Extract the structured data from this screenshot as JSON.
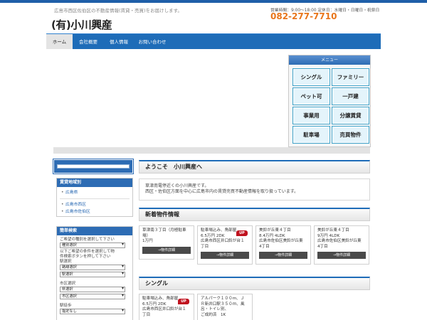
{
  "header": {
    "tagline": "広島市西区佐伯区の不動産情報(賃貸・売買)をお届けします。",
    "logo": "(有)小川興産",
    "hours": "営業時間：9:00〜18:00 定休日：水曜日・日曜日・祝祭日",
    "phone": "082-277-7710"
  },
  "nav": {
    "items": [
      {
        "label": "ホーム"
      },
      {
        "label": "会社概要"
      },
      {
        "label": "個人情報"
      },
      {
        "label": "お問い合わせ"
      }
    ]
  },
  "menu": {
    "title": "メニュー",
    "buttons": [
      "シングル",
      "ファミリー",
      "ペット可",
      "一戸建",
      "事業用",
      "分譲賃貸",
      "駐車場",
      "売買物件"
    ]
  },
  "sidebar": {
    "area_title": "賃貸地域別",
    "area_links": [
      "広島県",
      "広島市西区",
      "広島市佐伯区"
    ],
    "search_title": "簡単検索",
    "search_lines": [
      "ご希望の種別を選択して下さい"
    ],
    "type_select": "種別選択",
    "search_lines2": [
      "以下ご希望の条件を選択して物",
      "件検索ボタンを押して下さい"
    ],
    "station_label": "駅選択",
    "route_select": "路線選択",
    "station_select": "駅選択",
    "city_label": "市区選択",
    "pref_select": "県選択",
    "city_select": "市区選択",
    "walk_label": "駅徒歩",
    "walk_select": "指定なし"
  },
  "welcome": {
    "title": "ようこそ　小川興産へ",
    "line1": "草津南電停近くの小川興産です。",
    "line2": "西区・佐伯区方面を中心に広島市内の賃貸売買不動産情報を取り扱っています。"
  },
  "new_listings": {
    "title": "新着物件情報",
    "detail_label": "→物件詳細",
    "up_label": "UP",
    "cards": [
      {
        "lines": [
          "草津南３丁目（月極駐車",
          "場）",
          "1万円"
        ],
        "up": false
      },
      {
        "lines": [
          "駐車場込み、角部屋",
          "6.5万円 2DK",
          "広島市西区井口鈴が台１",
          "丁目"
        ],
        "up": true
      },
      {
        "lines": [
          "美鈴が丘東４丁目",
          "8.4万円 4LDK",
          "広島市佐伯区美鈴が丘東",
          "4丁目"
        ],
        "up": false
      },
      {
        "lines": [
          "美鈴が丘東４丁目",
          "9万円 4LDK",
          "広島市佐伯区美鈴が丘東",
          "4丁目"
        ],
        "up": false
      }
    ]
  },
  "single": {
    "title": "シングル",
    "cards": [
      {
        "lines": [
          "駐車場込み、角部屋",
          "6.5万円 2DK",
          "広島市西区井口鈴が台１",
          "丁目"
        ],
        "up": true
      },
      {
        "lines": [
          "アルパーク１００m、Ｊ",
          "Ｒ新井口駅３５０ｍ、風",
          "呂・トイレ別、",
          "ご成約済　1K"
        ],
        "up": false
      }
    ]
  }
}
